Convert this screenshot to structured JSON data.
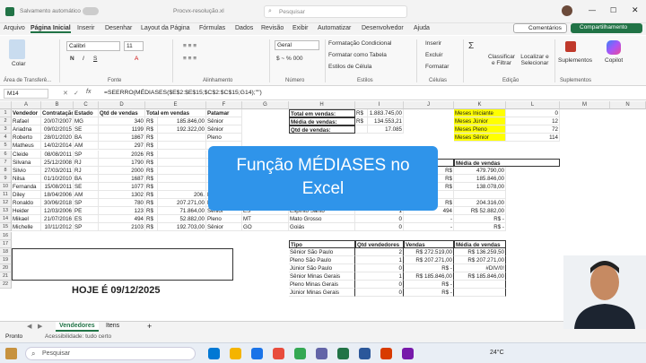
{
  "titlebar": {
    "autosave": "Salvamento automático",
    "doc": "Procvx-resolução.xl",
    "search": "Pesquisar"
  },
  "menu": [
    "Arquivo",
    "Página Inicial",
    "Inserir",
    "Desenhar",
    "Layout da Página",
    "Fórmulas",
    "Dados",
    "Revisão",
    "Exibir",
    "Automatizar",
    "Desenvolvedor",
    "Ajuda"
  ],
  "menu_right": {
    "comments": "Comentários",
    "share": "Compartilhamento"
  },
  "ribbon": {
    "paste": "Colar",
    "clipboard": "Área de Transferê...",
    "font_name": "Calibri",
    "font_size": "11",
    "font_group": "Fonte",
    "align_group": "Alinhamento",
    "number_format": "Geral",
    "number_group": "Número",
    "cond_format": "Formatação Condicional",
    "table_format": "Formatar como Tabela",
    "cell_styles": "Estilos de Célula",
    "styles_group": "Estilos",
    "insert": "Inserir",
    "delete": "Excluir",
    "format": "Formatar",
    "cells_group": "Células",
    "sort": "Classificar e Filtrar",
    "find": "Localizar e Selecionar",
    "edit_group": "Edição",
    "addins": "Suplementos",
    "addins_group": "Suplementos",
    "copilot": "Copilot"
  },
  "formula_bar": {
    "cell": "M14",
    "fx": "fx",
    "formula": "=SEERRO(MÉDIASES($E$2:$E$15;$C$2:$C$15;G14);\"\")"
  },
  "columns": [
    "A",
    "B",
    "C",
    "D",
    "E",
    "F",
    "G",
    "H",
    "I",
    "J",
    "K",
    "L",
    "M",
    "N"
  ],
  "rows": [
    "1",
    "2",
    "3",
    "4",
    "5",
    "6",
    "7",
    "8",
    "9",
    "10",
    "11",
    "12",
    "13",
    "14",
    "15",
    "16",
    "17",
    "18",
    "19",
    "20",
    "21",
    "22"
  ],
  "table_main": {
    "headers": [
      "Vendedor",
      "Contratação",
      "Estado",
      "Qtd de vendas",
      "Total em vendas",
      "Patamar"
    ],
    "rows": [
      [
        "Rafael",
        "20/07/2007",
        "MG",
        "340",
        "R$",
        "185.846,00",
        "Sênior"
      ],
      [
        "Ariadna",
        "09/02/2015",
        "SE",
        "1199",
        "R$",
        "192.322,00",
        "Sênior"
      ],
      [
        "Roberto",
        "28/01/2020",
        "BA",
        "1867",
        "R$",
        "",
        "Pleno"
      ],
      [
        "Matheus",
        "14/02/2014",
        "AM",
        "297",
        "R$",
        "",
        ""
      ],
      [
        "Cleide",
        "08/08/2011",
        "SP",
        "2026",
        "R$",
        "",
        ""
      ],
      [
        "Silvana",
        "25/12/2008",
        "RJ",
        "1790",
        "R$",
        "",
        ""
      ],
      [
        "Silvio",
        "27/03/2011",
        "RJ",
        "2000",
        "R$",
        "",
        ""
      ],
      [
        "Nilsa",
        "01/10/2010",
        "BA",
        "1687",
        "R$",
        "",
        ""
      ],
      [
        "Fernanda",
        "15/08/2011",
        "SE",
        "1077",
        "R$",
        "",
        ""
      ],
      [
        "Diley",
        "18/04/2006",
        "AM",
        "1302",
        "R$",
        "206.",
        "Pleno"
      ],
      [
        "Ronaldo",
        "30/06/2018",
        "SP",
        "780",
        "R$",
        "207.271,00",
        "Pleno"
      ],
      [
        "Heider",
        "12/03/2006",
        "PE",
        "123",
        "R$",
        "71.864,00",
        "Sênior"
      ],
      [
        "Mikael",
        "21/07/2016",
        "ES",
        "494",
        "R$",
        "52.882,00",
        "Pleno"
      ],
      [
        "Michelle",
        "10/11/2012",
        "SP",
        "2103",
        "R$",
        "192.703,00",
        "Sênior"
      ]
    ]
  },
  "g_col": [
    "ES",
    "MT",
    "GO"
  ],
  "summary": [
    [
      "Total em vendas:",
      "R$",
      "1.883.745,00"
    ],
    [
      "Média de vendas:",
      "R$",
      "134.553,21"
    ],
    [
      "Qtd de vendas:",
      "",
      "17.085"
    ]
  ],
  "months": [
    [
      "Meses Iniciante",
      "0"
    ],
    [
      "Meses Júnior",
      "12"
    ],
    [
      "Meses Pleno",
      "72"
    ],
    [
      "Meses Sênior",
      "114"
    ]
  ],
  "state_table": {
    "headers": [
      "Vendas",
      "Média de vendas"
    ],
    "rows": [
      [
        "",
        "09",
        "R$",
        "479.790,00"
      ],
      [
        "",
        "40",
        "R$",
        "185.846,00"
      ],
      [
        "",
        "90",
        "R$",
        "138.078,00"
      ],
      [
        "",
        "",
        "",
        " "
      ],
      [
        "",
        "554",
        "R$",
        "204.316,00"
      ],
      [
        "Espírito Santo",
        "1",
        "494",
        "R$ 52.882,00"
      ],
      [
        "Mato Grosso",
        "0",
        "-",
        "R$ -"
      ],
      [
        "Goiás",
        "0",
        "-",
        "R$ -"
      ]
    ]
  },
  "tipo_table": {
    "headers": [
      "Tipo",
      "Qtd vendedores",
      "Vendas",
      "Média de vendas"
    ],
    "rows": [
      [
        "Sênior São Paulo",
        "2",
        "R$ 272.519,00",
        "R$ 136.259,50"
      ],
      [
        "Pleno São Paulo",
        "1",
        "R$ 207.271,00",
        "R$ 207.271,00"
      ],
      [
        "Júnior São Paulo",
        "0",
        "R$ -",
        "#DIV/0!"
      ],
      [
        "Sênior Minas Gerais",
        "1",
        "R$ 185.846,00",
        "R$ 185.846,00"
      ],
      [
        "Pleno Minas Gerais",
        "0",
        "R$ -",
        ""
      ],
      [
        "Júnior Minas Gerais",
        "0",
        "R$ -",
        ""
      ]
    ]
  },
  "overlay": {
    "line1": "Função  MÉDIASES no",
    "line2": "Excel"
  },
  "today": "HOJE É 09/12/2025",
  "sheet_tabs": [
    "Vendedores",
    "Itens"
  ],
  "status": {
    "ready": "Pronto",
    "access": "Acessibilidade: tudo certo"
  },
  "taskbar": {
    "search": "Pesquisar",
    "weather": "24°C"
  },
  "colors": {
    "accent": "#217346",
    "yellow": "#ffff00",
    "overlay": "#2f94ea"
  }
}
